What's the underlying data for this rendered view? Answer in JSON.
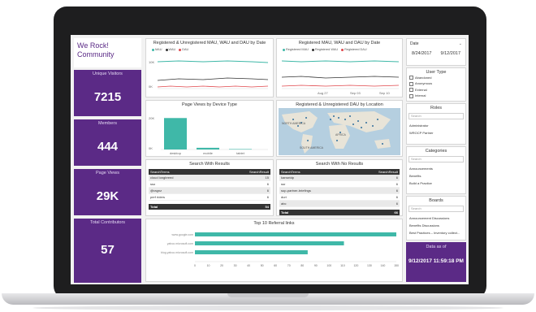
{
  "brand": {
    "line1": "We Rock!",
    "line2": "Community"
  },
  "kpis": [
    {
      "label": "Unique Visitors",
      "value": "7215"
    },
    {
      "label": "Members",
      "value": "444"
    },
    {
      "label": "Page Views",
      "value": "29K"
    },
    {
      "label": "Total Contributors",
      "value": "57"
    }
  ],
  "charts": {
    "mau_all": {
      "title": "Registered & Unregistered MAU, WAU and DAU by Date",
      "legend": [
        "MAU",
        "WAU",
        "DAU"
      ],
      "y_ticks": [
        "10K",
        "0K"
      ]
    },
    "mau_reg": {
      "title": "Registered MAU, WAU and DAU by Date",
      "legend": [
        "Registered MAU",
        "Registered WAU",
        "Registered DAU"
      ],
      "x_ticks": [
        "Aug 27",
        "Sep 03",
        "Sep 10"
      ]
    },
    "page_views": {
      "title": "Page Views by Device Type",
      "y_ticks": [
        "20K",
        "0K"
      ]
    },
    "dau_location": {
      "title": "Registered & Unregistered DAU by Location",
      "labels": [
        "NORTH AMERICA",
        "AFRICA",
        "SOUTH AMERICA"
      ]
    },
    "referral": {
      "title": "Top 10 Referral links",
      "x_ticks": [
        "0",
        "10",
        "20",
        "30",
        "40",
        "50",
        "60",
        "70",
        "80",
        "90",
        "100",
        "110",
        "120",
        "130",
        "140",
        "150"
      ]
    }
  },
  "chart_data": [
    {
      "type": "bar",
      "title": "Page Views by Device Type",
      "categories": [
        "desktop",
        "mobile",
        "tablet"
      ],
      "values": [
        22000,
        1200,
        300
      ],
      "ylim": [
        0,
        25000
      ]
    },
    {
      "type": "bar",
      "title": "Top 10 Referral links",
      "categories": [
        "www.google.com",
        "yahoo.microsoft.com",
        "blog.yahoo.microsoft.com"
      ],
      "values": [
        150,
        111,
        84
      ],
      "xlim": [
        0,
        150
      ]
    }
  ],
  "search_results": {
    "title": "Search With Results",
    "header": [
      "SearchTerms",
      "SearchResult"
    ],
    "rows": [
      [
        "cloud longbreed",
        "15"
      ],
      [
        "sso",
        "6"
      ],
      [
        "@ragnz",
        "6"
      ],
      [
        "perf riders",
        "6"
      ]
    ],
    "total": [
      "Total",
      "54"
    ]
  },
  "search_noresults": {
    "title": "Search With No Results",
    "header": [
      "SearchTerms",
      "SearchResult"
    ],
    "rows": [
      [
        "kanseidp",
        "6"
      ],
      [
        "ssr",
        "6"
      ],
      [
        "sup-partner-briefings",
        "6"
      ],
      [
        "duri",
        "6"
      ],
      [
        "abc",
        "6"
      ]
    ],
    "total": [
      "Total",
      "66"
    ]
  },
  "filters": {
    "date": {
      "label": "Date",
      "from": "8/24/2017",
      "to": "9/12/2017"
    },
    "user_type": {
      "title": "User Type",
      "options": [
        "Abandoned",
        "Anonymous",
        "External",
        "Internal"
      ]
    },
    "roles": {
      "title": "Roles",
      "search": "Search",
      "items": [
        "Administrator",
        "WROCP Partner"
      ]
    },
    "categories": {
      "title": "Categories",
      "search": "Search",
      "items": [
        "Announcements",
        "Benefits",
        "Build a Practice"
      ]
    },
    "boards": {
      "title": "Boards",
      "search": "Search",
      "items": [
        "Announcement Discussions",
        "Benefits Discussions",
        "Best Practices – Inventory collect..."
      ]
    }
  },
  "data_as_of": {
    "label": "Data as of",
    "value": "9/12/2017 11:59:18 PM"
  },
  "colors": {
    "purple": "#5b2a86",
    "teal": "#3fb8a8",
    "dark": "#333333"
  }
}
